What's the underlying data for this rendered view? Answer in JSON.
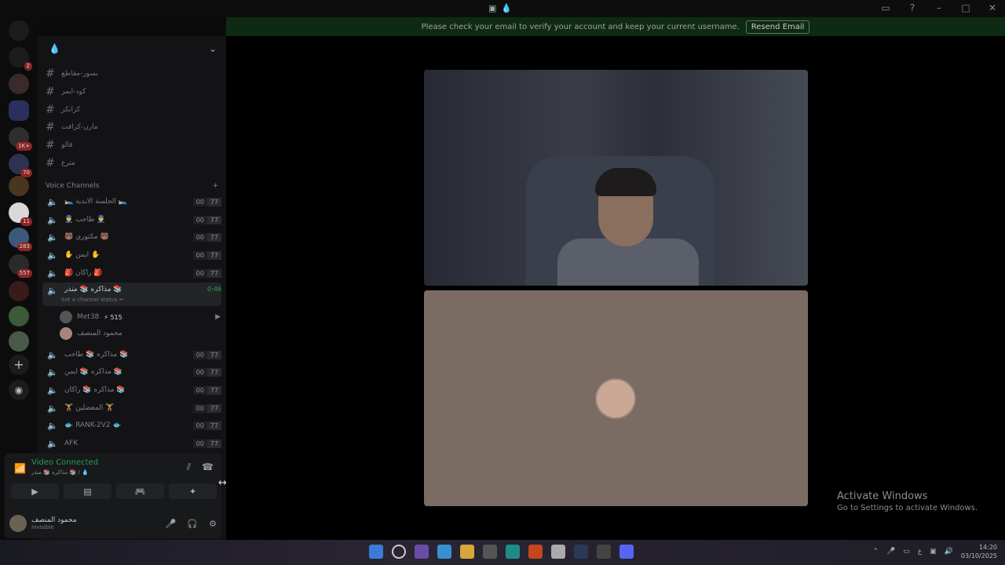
{
  "window": {
    "title_glyph": "💧"
  },
  "banner": {
    "message": "Please check your email to verify your account and keep your current username.",
    "button": "Resend Email"
  },
  "rail": {
    "badges": [
      {
        "label": "2"
      },
      {
        "label": "1K+"
      },
      {
        "label": "70"
      },
      {
        "label": "11"
      },
      {
        "label": "283"
      },
      {
        "label": "557"
      }
    ]
  },
  "server": {
    "name": "💧"
  },
  "text_channels": [
    {
      "name": "بسور-مقاطع"
    },
    {
      "name": "كود-ايمز"
    },
    {
      "name": "كرانكز"
    },
    {
      "name": "مارن-كرافت"
    },
    {
      "name": "قالو"
    },
    {
      "name": "مترع"
    }
  ],
  "voice_category": "Voice Channels",
  "voice_channels": [
    {
      "name": "🛌 الجلسة الابدية 🛌",
      "c1": "00",
      "c2": "77"
    },
    {
      "name": "👮 طاحب 👮",
      "c1": "00",
      "c2": "77"
    },
    {
      "name": "🐻 مكتوري 🐻",
      "c1": "00",
      "c2": "77"
    },
    {
      "name": "✋ ايمن ✋",
      "c1": "00",
      "c2": "77"
    },
    {
      "name": "🎒 راكان 🎒",
      "c1": "00",
      "c2": "77"
    }
  ],
  "active_channel": {
    "name": "مذاكره 📚 منذر 📚",
    "status": "Set a channel status ✏",
    "timer": "0:46"
  },
  "channel_users": [
    {
      "name": "Met38",
      "boost": "⚡ 515"
    },
    {
      "name": "محمود المنصف",
      "boost": ""
    }
  ],
  "voice_channels_2": [
    {
      "name": "مذاكره 📚 طاحب 📚",
      "c1": "00",
      "c2": "77"
    },
    {
      "name": "مذاكره 📚 ايمن 📚",
      "c1": "00",
      "c2": "77"
    },
    {
      "name": "مذاكره 📚 راكان 📚",
      "c1": "00",
      "c2": "77"
    },
    {
      "name": "🏋 المعضلين 🏋",
      "c1": "00",
      "c2": "77"
    },
    {
      "name": "🐟 RANK-2V2 🐟",
      "c1": "00",
      "c2": "77"
    },
    {
      "name": "AFK",
      "c1": "00",
      "c2": "77"
    }
  ],
  "voice_panel": {
    "title": "Video Connected",
    "subtitle": "مذاكره 📚 منذر 📚 / 💧"
  },
  "me": {
    "name": "محمود المنصف",
    "status": "Invisible"
  },
  "activate": {
    "line1": "Activate Windows",
    "line2": "Go to Settings to activate Windows."
  },
  "clock": {
    "time": "14:20",
    "date": "03/10/2025"
  },
  "tray": {
    "lang": "ع"
  }
}
